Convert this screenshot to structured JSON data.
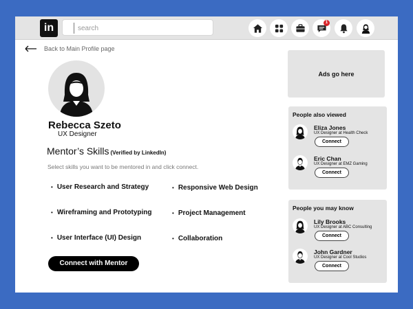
{
  "header": {
    "logo_text": "in",
    "search_placeholder": "search",
    "nav_icons": [
      "home-icon",
      "network-icon",
      "jobs-icon",
      "messaging-icon",
      "notifications-icon",
      "me-avatar"
    ],
    "message_badge": "1"
  },
  "back_link": "Back to Main Profile page",
  "profile": {
    "name": "Rebecca Szeto",
    "title": "UX Designer"
  },
  "skills": {
    "heading": "Mentor’s Skills",
    "verified": "(Verified by LinkedIn)",
    "instruction": "Select skills you want to be mentored in and click connect.",
    "left": [
      "User Research and Strategy",
      "Wireframing and Prototyping",
      "User Interface (UI) Design"
    ],
    "right": [
      "Responsive Web Design",
      "Project Management",
      "Collaboration"
    ]
  },
  "cta_label": "Connect with Mentor",
  "ads_label": "Ads go here",
  "people_also_viewed": {
    "title": "People also viewed",
    "people": [
      {
        "name": "Eliza Jones",
        "role": "UX Designer at Health Check",
        "action": "Connect"
      },
      {
        "name": "Eric Chan",
        "role": "UX Designer at EMZ Gaming",
        "action": "Connect"
      }
    ]
  },
  "people_you_may_know": {
    "title": "People you may know",
    "people": [
      {
        "name": "Lily Brooks",
        "role": "UX Designer at ABC Consulting",
        "action": "Connect"
      },
      {
        "name": "John Gardner",
        "role": "UX Designer at Cool Studios",
        "action": "Connect"
      }
    ]
  },
  "colors": {
    "background": "#3b6bc2",
    "topbar": "#e4e4e4",
    "panel": "#e4e4e4",
    "cta": "#000000",
    "badge": "#d9252a"
  }
}
